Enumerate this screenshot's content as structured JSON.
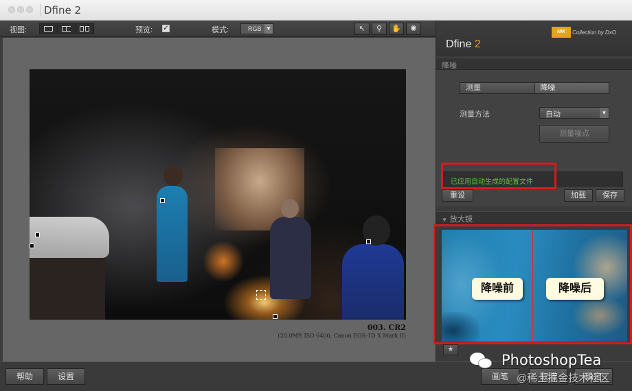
{
  "window": {
    "title": "Dfine 2"
  },
  "toolbar": {
    "view_label": "视图:",
    "preview_label": "预览:",
    "preview_checked": "✓",
    "mode_label": "模式:",
    "mode_value": "RGB",
    "tool_icons": [
      "arrow-pointer-icon",
      "magnifier-icon",
      "hand-icon",
      "light-bulb-icon"
    ]
  },
  "image": {
    "file_name": "003. CR2",
    "file_meta": "(20.0MP, ISO 6400, Canon EOS-1D X Mark II)"
  },
  "panel": {
    "brand_logo": "NIK",
    "collection": "Collection by DxO",
    "product_name": "Dfine",
    "product_version": "2",
    "section_noise": "降噪",
    "tabs": [
      "测量",
      "降噪"
    ],
    "method_label": "测量方法",
    "method_value": "自动",
    "measure_button": "测量噪点",
    "status_text": "已应用自动生成的配置文件",
    "reset_button": "重设",
    "load_button": "加载",
    "save_button": "保存",
    "section_loupe": "放大镜",
    "loupe_before": "降噪前",
    "loupe_after": "降噪后"
  },
  "bottom": {
    "help": "帮助",
    "settings": "设置",
    "brush": "画笔",
    "cancel": "取消",
    "ok": "确定"
  },
  "watermark": {
    "text": "PhotoshopTea",
    "subtext": "@稀土掘金技术社区"
  },
  "colors": {
    "accent": "#e7a21b",
    "status_green": "#5fc140",
    "highlight_red": "#d91a1a"
  }
}
